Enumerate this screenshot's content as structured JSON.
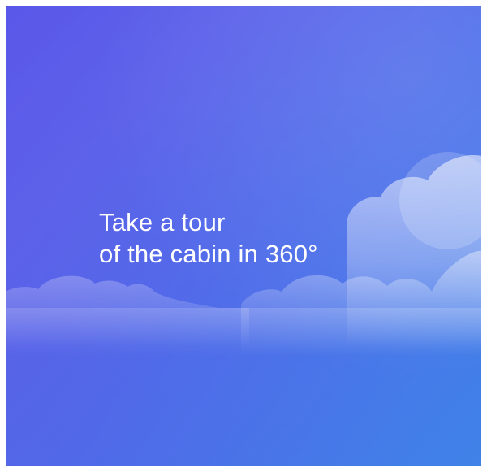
{
  "hero": {
    "headline_line1": "Take a tour",
    "headline_line2": "of the cabin in 360°"
  },
  "colors": {
    "gradient_start": "#5a57e8",
    "gradient_end": "#3f82e8",
    "cloud": "#ffffff",
    "text": "#ffffff"
  },
  "icons": [
    "cloud-illustration"
  ]
}
